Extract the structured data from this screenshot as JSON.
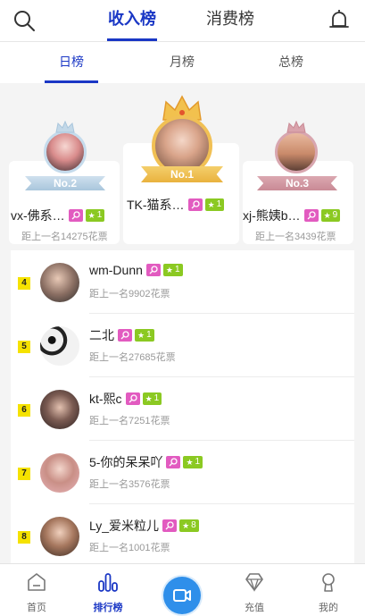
{
  "header": {
    "tabs": [
      {
        "label": "收入榜",
        "active": true
      },
      {
        "label": "消费榜",
        "active": false
      }
    ],
    "search_icon": "search-icon",
    "bell_icon": "bell-icon"
  },
  "subtabs": [
    {
      "label": "日榜",
      "active": true
    },
    {
      "label": "月榜",
      "active": false
    },
    {
      "label": "总榜",
      "active": false
    }
  ],
  "podium": {
    "first": {
      "rank_label": "No.1",
      "name": "TK-猫系…",
      "level": "1",
      "distance": ""
    },
    "second": {
      "rank_label": "No.2",
      "name": "vx-佛系…",
      "level": "1",
      "distance": "距上一名14275花票"
    },
    "third": {
      "rank_label": "No.3",
      "name": "xj-熊姨b…",
      "level": "9",
      "distance": "距上一名3439花票"
    }
  },
  "ranking": [
    {
      "rank": "4",
      "name": "wm-Dunn",
      "level": "1",
      "distance": "距上一名9902花票"
    },
    {
      "rank": "5",
      "name": "二北",
      "level": "1",
      "distance": "距上一名27685花票"
    },
    {
      "rank": "6",
      "name": "kt-熙c",
      "level": "1",
      "distance": "距上一名7251花票"
    },
    {
      "rank": "7",
      "name": "5-你的呆呆吖",
      "level": "1",
      "distance": "距上一名3576花票"
    },
    {
      "rank": "8",
      "name": "Ly_爱米粒儿",
      "level": "8",
      "distance": "距上一名1001花票"
    }
  ],
  "bottom_nav": [
    {
      "label": "首页",
      "icon": "home-icon",
      "active": false
    },
    {
      "label": "排行榜",
      "icon": "ranking-icon",
      "active": true
    },
    {
      "label": "",
      "icon": "live-camera-icon",
      "active": false
    },
    {
      "label": "充值",
      "icon": "diamond-icon",
      "active": false
    },
    {
      "label": "我的",
      "icon": "profile-icon",
      "active": false
    }
  ],
  "colors": {
    "accent": "#1a37c5",
    "pink_badge": "#e25bc0",
    "green_badge": "#8bc922",
    "rank_yellow": "#f5e200",
    "gold": "#e9b23e",
    "silver": "#a9c6dc",
    "bronze": "#c98a95",
    "center_button": "#2f8fea"
  }
}
